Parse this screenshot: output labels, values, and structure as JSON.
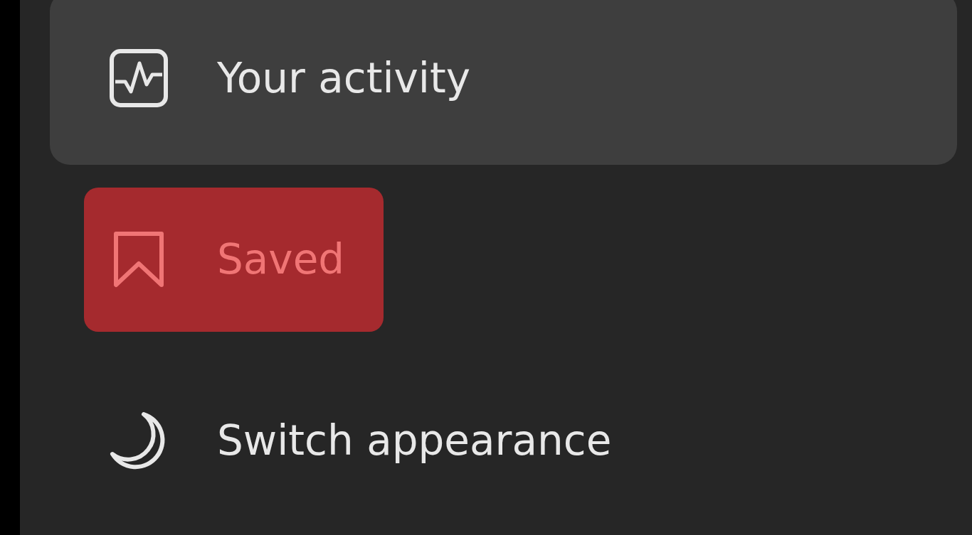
{
  "menu": {
    "items": [
      {
        "kind": "activity",
        "label": "Your activity",
        "hovered": true,
        "selected": false
      },
      {
        "kind": "saved",
        "label": "Saved",
        "hovered": false,
        "selected": true
      },
      {
        "kind": "appearance",
        "label": "Switch appearance",
        "hovered": false,
        "selected": false
      }
    ]
  }
}
